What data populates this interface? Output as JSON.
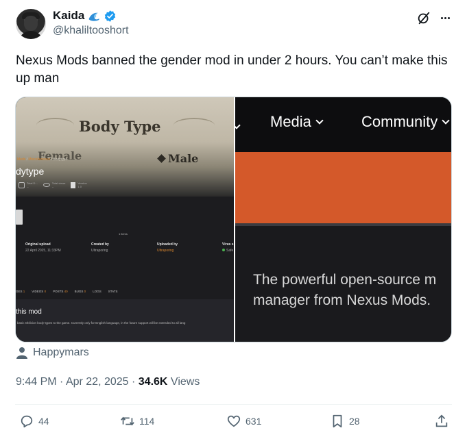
{
  "author": {
    "name": "Kaida",
    "handle": "@khaliltooshort"
  },
  "icons": {
    "wave": "wave-emoji",
    "verified": "verified-badge",
    "grok": "grok-icon",
    "more": "more-icon",
    "accent": "#1d9bf0"
  },
  "tweet": {
    "text": "Nexus Mods banned the gender mod in under 2 hours. You can’t make this up man"
  },
  "media": {
    "left": {
      "banner_title": "Body Type",
      "option_female": "Female",
      "option_male": "Male",
      "breadcrumb_home": "Mods",
      "breadcrumb_sep1": " / ",
      "breadcrumb_section": "Miscellaneous",
      "breadcrumb_sep2": " / ",
      "breadcrumb_current": "Bodytype",
      "mod_title": "dytype",
      "stats": [
        {
          "label": "Total D...",
          "value": "--"
        },
        {
          "label": "Total views",
          "value": "--"
        },
        {
          "label": "Version",
          "value": "1.0"
        }
      ],
      "images_count": "1 items",
      "meta": [
        {
          "key": "Original upload",
          "value": "22 April 2025,  11:33PM"
        },
        {
          "key": "Created by",
          "value": "Ultraporing"
        },
        {
          "key": "Uploaded by",
          "value": "Ultraporing"
        },
        {
          "key": "Virus s",
          "value": "Safe"
        }
      ],
      "tabs": [
        {
          "label": "GES",
          "count": "1"
        },
        {
          "label": "VIDEOS",
          "count": "0"
        },
        {
          "label": "POSTS",
          "count": "40"
        },
        {
          "label": "BUGS",
          "count": "0"
        },
        {
          "label": "LOGS",
          "count": ""
        },
        {
          "label": "STATS",
          "count": ""
        }
      ],
      "section_title": "this mod",
      "section_desc": "basic Oblivion body-types to the game. Currently only for English language, in the future support will be extended to all lang"
    },
    "right": {
      "nav_media": "Media",
      "nav_community": "Community",
      "description_line1": "The powerful open-source m",
      "description_line2": "manager from Nexus Mods."
    }
  },
  "tagged_user": "Happymars",
  "meta": {
    "time": "9:44 PM",
    "sep1": " · ",
    "date": "Apr 22, 2025",
    "sep2": " · ",
    "views_count": "34.6K",
    "views_label": " Views"
  },
  "actions": {
    "replies": "44",
    "reposts": "114",
    "likes": "631",
    "bookmarks": "28"
  }
}
